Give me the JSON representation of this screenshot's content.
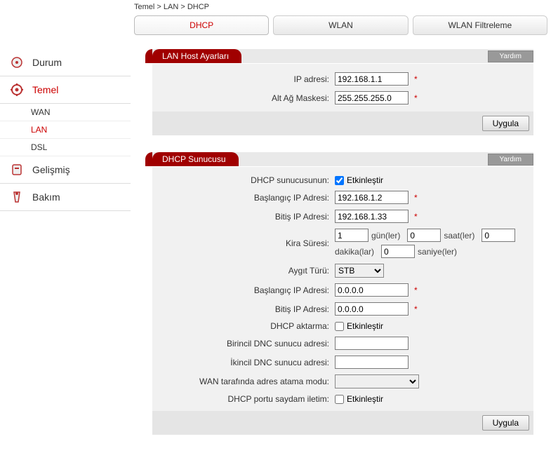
{
  "breadcrumb": "Temel > LAN > DHCP",
  "sidebar": {
    "items": [
      {
        "label": "Durum"
      },
      {
        "label": "Temel"
      },
      {
        "label": "Gelişmiş"
      },
      {
        "label": "Bakım"
      }
    ],
    "sub": [
      {
        "label": "WAN"
      },
      {
        "label": "LAN"
      },
      {
        "label": "DSL"
      }
    ]
  },
  "tabs": [
    {
      "label": "DHCP"
    },
    {
      "label": "WLAN"
    },
    {
      "label": "WLAN Filtreleme"
    }
  ],
  "help_label": "Yardım",
  "apply_label": "Uygula",
  "section1": {
    "title": "LAN Host Ayarları",
    "ip_label": "IP adresi:",
    "ip_value": "192.168.1.1",
    "mask_label": "Alt Ağ Maskesi:",
    "mask_value": "255.255.255.0"
  },
  "section2": {
    "title": "DHCP Sunucusu",
    "dhcp_server_label": "DHCP sunucusunun:",
    "enable_label": "Etkinleştir",
    "start_ip_label": "Başlangıç IP Adresi:",
    "start_ip_value": "192.168.1.2",
    "end_ip_label": "Bitiş IP Adresi:",
    "end_ip_value": "192.168.1.33",
    "lease_label": "Kira Süresi:",
    "lease_day": "1",
    "lease_day_unit": "gün(ler)",
    "lease_hour": "0",
    "lease_hour_unit": "saat(ler)",
    "lease_min": "0",
    "lease_min_unit": "dakika(lar)",
    "lease_sec": "0",
    "lease_sec_unit": "saniye(ler)",
    "device_type_label": "Aygıt Türü:",
    "device_type_value": "STB",
    "dev_start_ip_label": "Başlangıç IP Adresi:",
    "dev_start_ip_value": "0.0.0.0",
    "dev_end_ip_label": "Bitiş IP Adresi:",
    "dev_end_ip_value": "0.0.0.0",
    "relay_label": "DHCP aktarma:",
    "dns1_label": "Birincil DNC sunucu adresi:",
    "dns1_value": "",
    "dns2_label": "İkincil DNC sunucu adresi:",
    "dns2_value": "",
    "wan_mode_label": "WAN tarafında adres atama modu:",
    "transparent_label": "DHCP portu saydam iletim:"
  }
}
